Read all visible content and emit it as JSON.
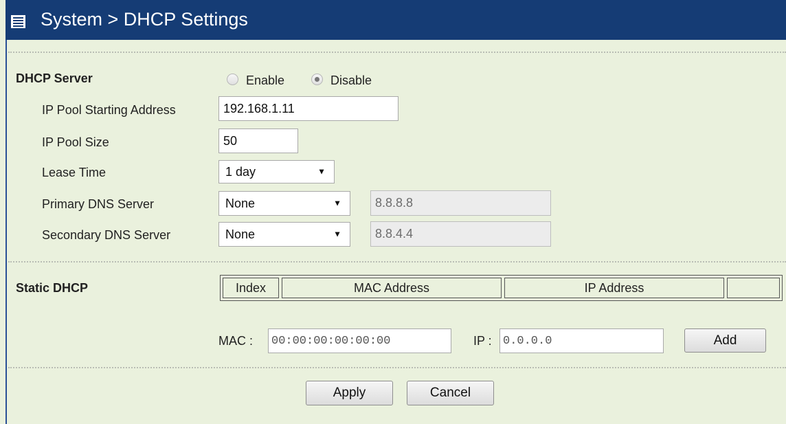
{
  "header": {
    "title": "System > DHCP Settings"
  },
  "dhcp_server": {
    "label": "DHCP Server",
    "enable_label": "Enable",
    "disable_label": "Disable",
    "selected": "Disable"
  },
  "fields": {
    "pool_start": {
      "label": "IP Pool Starting Address",
      "value": "192.168.1.11"
    },
    "pool_size": {
      "label": "IP Pool Size",
      "value": "50"
    },
    "lease_time": {
      "label": "Lease Time",
      "value": "1 day"
    },
    "primary_dns": {
      "label": "Primary DNS Server",
      "mode": "None",
      "value": "8.8.8.8"
    },
    "secondary_dns": {
      "label": "Secondary DNS Server",
      "mode": "None",
      "value": "8.8.4.4"
    }
  },
  "static_dhcp": {
    "label": "Static DHCP",
    "columns": [
      "Index",
      "MAC Address",
      "IP Address",
      ""
    ],
    "mac_label": "MAC :",
    "mac_value": "00:00:00:00:00:00",
    "ip_label": "IP :",
    "ip_value": "0.0.0.0",
    "add_label": "Add"
  },
  "actions": {
    "apply_label": "Apply",
    "cancel_label": "Cancel"
  },
  "colors": {
    "header_bg": "#153c75",
    "page_bg": "#eaf1dd"
  }
}
